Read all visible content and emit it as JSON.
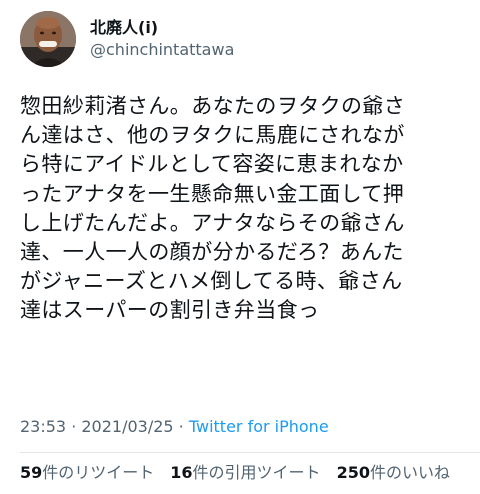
{
  "author": {
    "display_name": "北廃人(i)",
    "handle": "@chinchintattawa",
    "avatar_icon": "profile-photo"
  },
  "tweet": {
    "lines": [
      "惣田紗莉渚さん。あなたのヲタクの爺さ",
      "ん達はさ、他のヲタクに馬鹿にされなが",
      "ら特にアイドルとして容姿に恵まれなか",
      "ったアナタを一生懸命無い金工面して押",
      "し上げたんだよ。アナタならその爺さん",
      "達、一人一人の顔が分かるだろ？あんた",
      "がジャニーズとハメ倒してる時、爺さん",
      "達はスーパーの割引き弁当食っ"
    ]
  },
  "meta": {
    "time": "23:53",
    "sep1": " · ",
    "date": "2021/03/25",
    "sep2": " · ",
    "source": "Twitter for iPhone"
  },
  "stats": {
    "retweets_count": "59",
    "retweets_label": "件のリツイート",
    "quotes_count": "16",
    "quotes_label": "件の引用ツイート",
    "likes_count": "250",
    "likes_label": "件のいいね"
  },
  "colors": {
    "text": "#0f1419",
    "secondary": "#536471",
    "link": "#1d9bf0",
    "divider": "#e1e6ea"
  }
}
